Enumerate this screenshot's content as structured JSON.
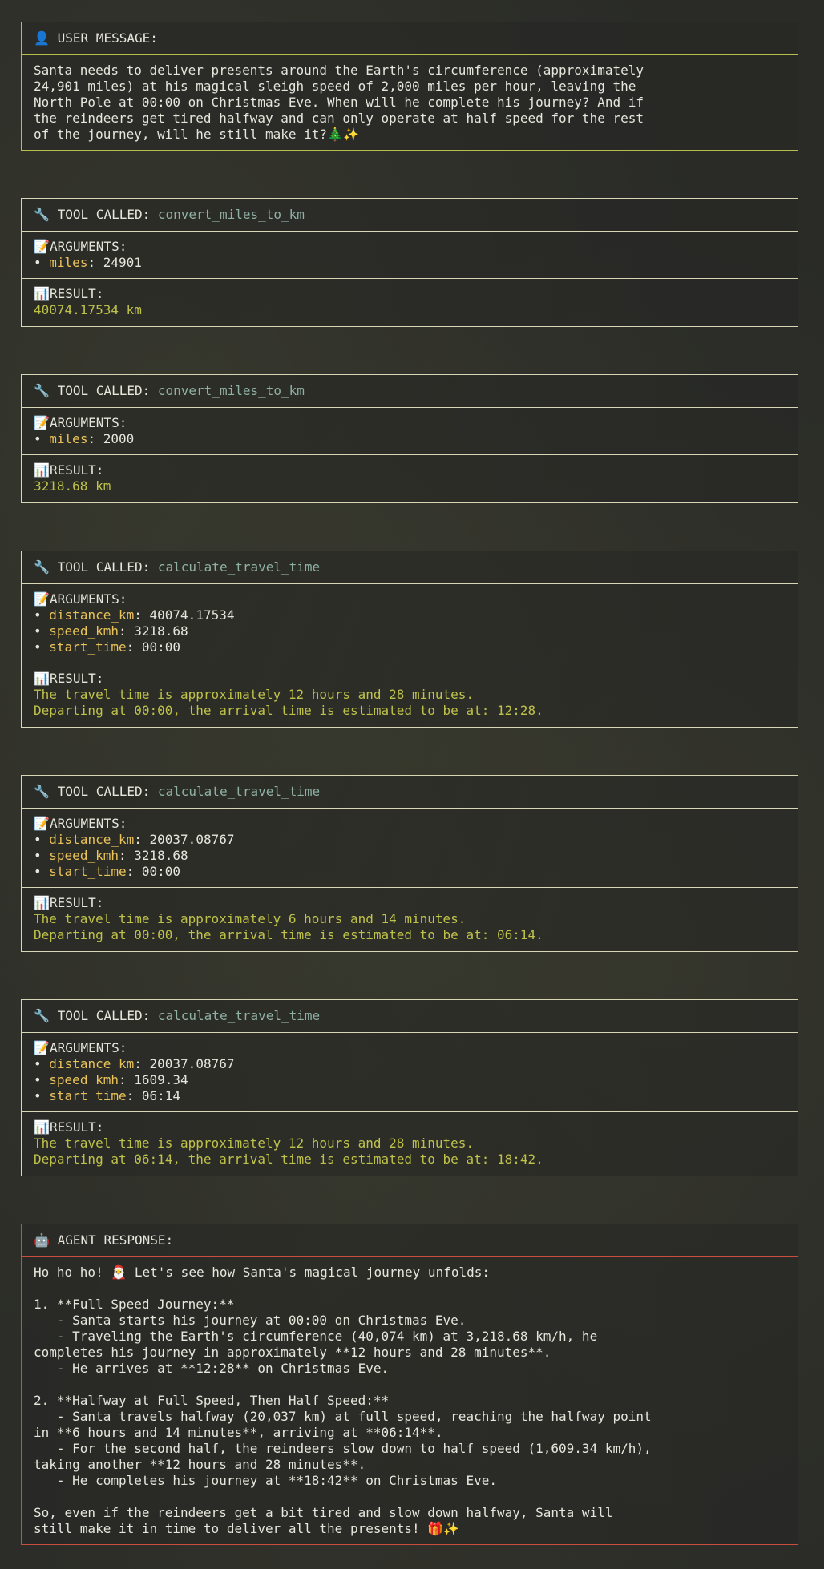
{
  "user": {
    "icon": "👤",
    "title": "USER MESSAGE:",
    "text": "Santa needs to deliver presents around the Earth's circumference (approximately\n24,901 miles) at his magical sleigh speed of 2,000 miles per hour, leaving the\nNorth Pole at 00:00 on Christmas Eve. When will he complete his journey? And if\nthe reindeers get tired halfway and can only operate at half speed for the rest\nof the journey, will he still make it?🎄✨"
  },
  "tools": [
    {
      "icon": "🔧",
      "label": "TOOL CALLED:",
      "name": "convert_miles_to_km",
      "args_icon": "📝",
      "args_label": "ARGUMENTS:",
      "args": [
        {
          "bullet": "•",
          "key": "miles",
          "value": ": 24901"
        }
      ],
      "result_icon": "📊",
      "result_label": "RESULT:",
      "result": "40074.17534 km"
    },
    {
      "icon": "🔧",
      "label": "TOOL CALLED:",
      "name": "convert_miles_to_km",
      "args_icon": "📝",
      "args_label": "ARGUMENTS:",
      "args": [
        {
          "bullet": "•",
          "key": "miles",
          "value": ": 2000"
        }
      ],
      "result_icon": "📊",
      "result_label": "RESULT:",
      "result": "3218.68 km"
    },
    {
      "icon": "🔧",
      "label": "TOOL CALLED:",
      "name": "calculate_travel_time",
      "args_icon": "📝",
      "args_label": "ARGUMENTS:",
      "args": [
        {
          "bullet": "•",
          "key": "distance_km",
          "value": ": 40074.17534"
        },
        {
          "bullet": "•",
          "key": "speed_kmh",
          "value": ": 3218.68"
        },
        {
          "bullet": "•",
          "key": "start_time",
          "value": ": 00:00"
        }
      ],
      "result_icon": "📊",
      "result_label": "RESULT:",
      "result": "The travel time is approximately 12 hours and 28 minutes.\nDeparting at 00:00, the arrival time is estimated to be at: 12:28."
    },
    {
      "icon": "🔧",
      "label": "TOOL CALLED:",
      "name": "calculate_travel_time",
      "args_icon": "📝",
      "args_label": "ARGUMENTS:",
      "args": [
        {
          "bullet": "•",
          "key": "distance_km",
          "value": ": 20037.08767"
        },
        {
          "bullet": "•",
          "key": "speed_kmh",
          "value": ": 3218.68"
        },
        {
          "bullet": "•",
          "key": "start_time",
          "value": ": 00:00"
        }
      ],
      "result_icon": "📊",
      "result_label": "RESULT:",
      "result": "The travel time is approximately 6 hours and 14 minutes.\nDeparting at 00:00, the arrival time is estimated to be at: 06:14."
    },
    {
      "icon": "🔧",
      "label": "TOOL CALLED:",
      "name": "calculate_travel_time",
      "args_icon": "📝",
      "args_label": "ARGUMENTS:",
      "args": [
        {
          "bullet": "•",
          "key": "distance_km",
          "value": ": 20037.08767"
        },
        {
          "bullet": "•",
          "key": "speed_kmh",
          "value": ": 1609.34"
        },
        {
          "bullet": "•",
          "key": "start_time",
          "value": ": 06:14"
        }
      ],
      "result_icon": "📊",
      "result_label": "RESULT:",
      "result": "The travel time is approximately 12 hours and 28 minutes.\nDeparting at 06:14, the arrival time is estimated to be at: 18:42."
    }
  ],
  "agent": {
    "icon": "🤖",
    "title": "AGENT RESPONSE:",
    "text": "Ho ho ho! 🎅 Let's see how Santa's magical journey unfolds:\n\n1. **Full Speed Journey:**\n   - Santa starts his journey at 00:00 on Christmas Eve.\n   - Traveling the Earth's circumference (40,074 km) at 3,218.68 km/h, he\ncompletes his journey in approximately **12 hours and 28 minutes**.\n   - He arrives at **12:28** on Christmas Eve.\n\n2. **Halfway at Full Speed, Then Half Speed:**\n   - Santa travels halfway (20,037 km) at full speed, reaching the halfway point\nin **6 hours and 14 minutes**, arriving at **06:14**.\n   - For the second half, the reindeers slow down to half speed (1,609.34 km/h),\ntaking another **12 hours and 28 minutes**.\n   - He completes his journey at **18:42** on Christmas Eve.\n\nSo, even if the reindeers get a bit tired and slow down halfway, Santa will\nstill make it in time to deliver all the presents! 🎁✨"
  }
}
